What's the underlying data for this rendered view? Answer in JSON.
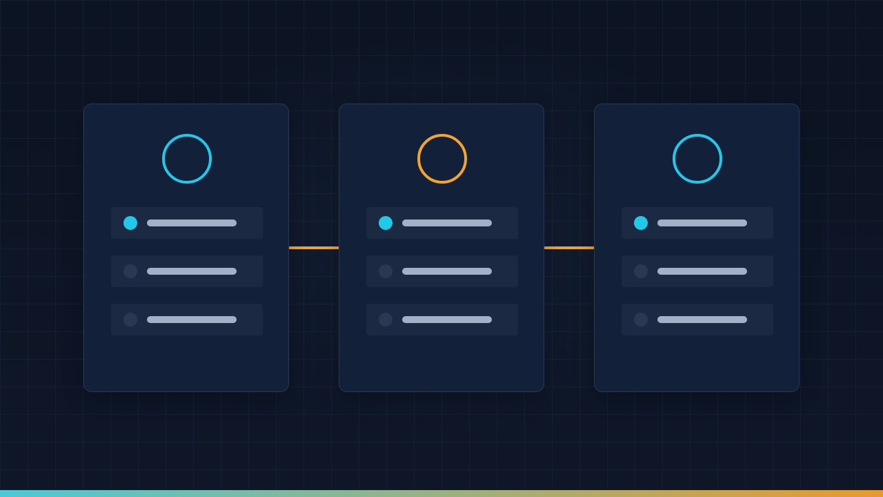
{
  "colors": {
    "cyan_accent": "#22c8e8",
    "orange_accent": "#f2a52a",
    "card_bg": "#13203a",
    "row_bg": "#1b2943",
    "inactive_dot": "#2a3953",
    "placeholder_bar": "#a3b0c6",
    "footer_gradient_start": "#4cc9d6",
    "footer_gradient_end": "#e89a2c"
  },
  "cards": [
    {
      "ring_icon": "circle-outline-icon",
      "ring_color": "#22c8e8",
      "active_row": 0,
      "row_count": 3
    },
    {
      "ring_icon": "circle-outline-icon",
      "ring_color": "#f2a52a",
      "active_row": 0,
      "row_count": 3
    },
    {
      "ring_icon": "circle-outline-icon",
      "ring_color": "#22c8e8",
      "active_row": 0,
      "row_count": 3
    }
  ],
  "connectors": [
    {
      "from": 0,
      "to": 1,
      "color": "#f2a52a"
    },
    {
      "from": 1,
      "to": 2,
      "color": "#f2a52a"
    }
  ]
}
